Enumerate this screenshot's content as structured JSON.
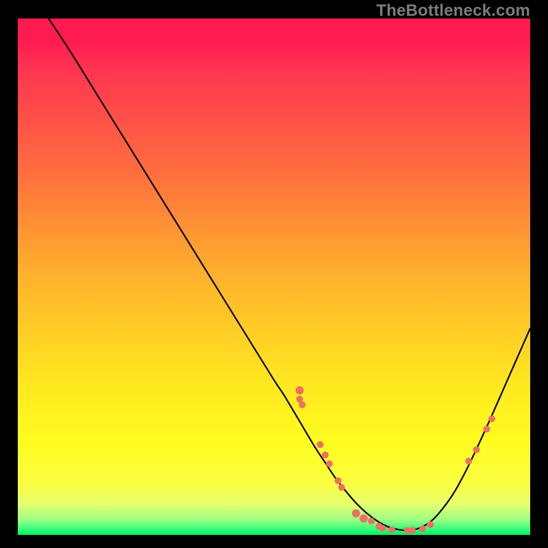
{
  "watermark": "TheBottleneck.com",
  "chart_data": {
    "type": "line",
    "title": "",
    "xlabel": "",
    "ylabel": "",
    "xlim": [
      0,
      100
    ],
    "ylim": [
      0,
      100
    ],
    "grid": false,
    "legend": null,
    "annotations": [],
    "series": [
      {
        "name": "curve",
        "color": "#000000",
        "x": [
          6,
          10,
          15,
          20,
          25,
          30,
          35,
          40,
          45,
          50,
          52,
          55,
          58,
          60,
          62,
          64,
          66,
          68,
          70,
          72,
          74,
          76,
          78,
          80,
          82,
          85,
          88,
          92,
          96,
          100
        ],
        "y": [
          100,
          94,
          86,
          78,
          70,
          62,
          54,
          46,
          38,
          30,
          27,
          22,
          17,
          14,
          11,
          8.5,
          6.2,
          4.3,
          2.8,
          1.7,
          1.1,
          0.9,
          1.2,
          2.2,
          4.0,
          8.0,
          13.5,
          22.0,
          31.0,
          40.0
        ]
      }
    ],
    "markers": [
      {
        "x": 55,
        "y": 28,
        "r": 6
      },
      {
        "x": 55,
        "y": 26.3,
        "r": 5
      },
      {
        "x": 55.5,
        "y": 25.2,
        "r": 5
      },
      {
        "x": 59,
        "y": 17.5,
        "r": 5
      },
      {
        "x": 60,
        "y": 15.5,
        "r": 5
      },
      {
        "x": 60.8,
        "y": 13.8,
        "r": 5
      },
      {
        "x": 62.5,
        "y": 10.5,
        "r": 5
      },
      {
        "x": 63.2,
        "y": 9.2,
        "r": 5
      },
      {
        "x": 66,
        "y": 4.2,
        "r": 6
      },
      {
        "x": 67.5,
        "y": 3.2,
        "r": 6
      },
      {
        "x": 69,
        "y": 2.7,
        "r": 5
      },
      {
        "x": 70.5,
        "y": 1.7,
        "r": 5
      },
      {
        "x": 71.2,
        "y": 1.3,
        "r": 5
      },
      {
        "x": 73,
        "y": 1.0,
        "r": 5
      },
      {
        "x": 76,
        "y": 0.9,
        "r": 5
      },
      {
        "x": 77,
        "y": 0.9,
        "r": 5
      },
      {
        "x": 79,
        "y": 1.2,
        "r": 5
      },
      {
        "x": 80.5,
        "y": 2.0,
        "r": 5
      },
      {
        "x": 88,
        "y": 14.3,
        "r": 5
      },
      {
        "x": 89.5,
        "y": 16.5,
        "r": 5
      },
      {
        "x": 91.5,
        "y": 20.5,
        "r": 5
      },
      {
        "x": 92.5,
        "y": 22.5,
        "r": 5
      }
    ],
    "marker_color": "#ec7063"
  }
}
